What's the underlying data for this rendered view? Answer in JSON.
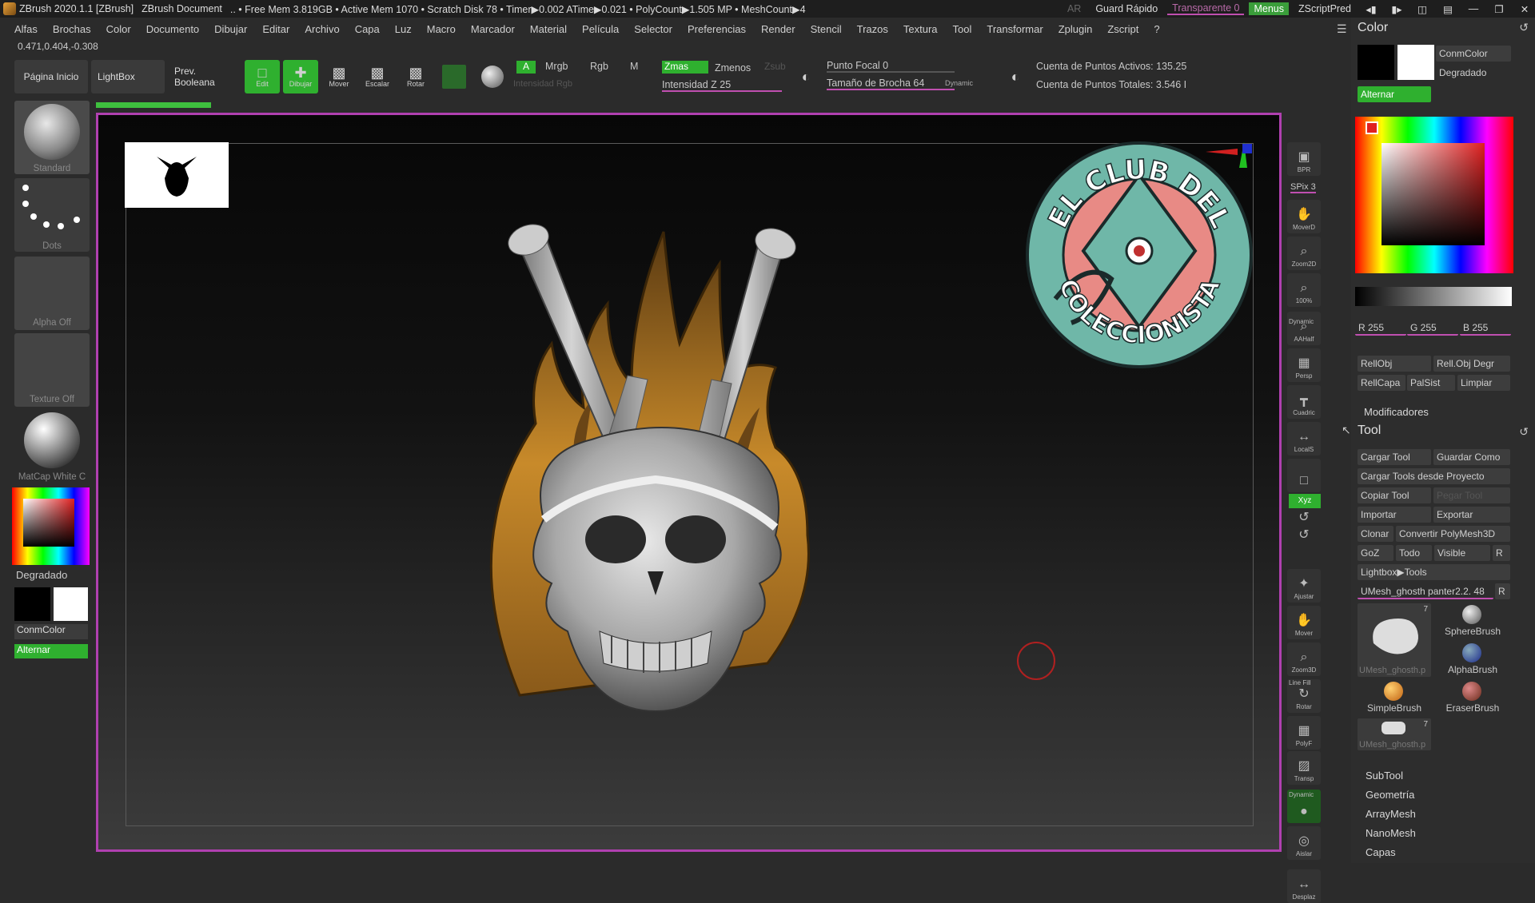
{
  "title_bar": {
    "app": "ZBrush 2020.1.1 [ZBrush]",
    "document": "ZBrush Document",
    "stats": ".. • Free Mem 3.819GB • Active Mem 1070 • Scratch Disk 78 •  Timer▶0.002 ATime▶0.021 • PolyCount▶1.505 MP  • MeshCount▶4",
    "ar": "AR",
    "guard_rapido": "Guard Rápido",
    "transparente": "Transparente 0",
    "menus": "Menus",
    "script": "ZScriptPred"
  },
  "menu_bar": [
    "Alfas",
    "Brochas",
    "Color",
    "Documento",
    "Dibujar",
    "Editar",
    "Archivo",
    "Capa",
    "Luz",
    "Macro",
    "Marcador",
    "Material",
    "Película",
    "Selector",
    "Preferencias",
    "Render",
    "Stencil",
    "Trazos",
    "Textura",
    "Tool",
    "Transformar",
    "Zplugin",
    "Zscript",
    "?"
  ],
  "coords": "0.471,0.404,-0.308",
  "top_tools": {
    "pagina_inicio": "Página Inicio",
    "lightbox": "LightBox",
    "prev_booleana": "Prev. Booleana",
    "edit": "Edit",
    "dibujar": "Dibujar",
    "mover": "Mover",
    "escalar": "Escalar",
    "rotar": "Rotar",
    "a": "A",
    "mrgb": "Mrgb",
    "rgb": "Rgb",
    "m": "M",
    "intensidad_rgb": "Intensidad Rgb",
    "zmas": "Zmas",
    "zmenos": "Zmenos",
    "zsub": "Zsub",
    "intensidad_z": "Intensidad Z 25",
    "punto_focal": "Punto Focal 0",
    "tamano_brocha": "Tamaño de Brocha 64",
    "dynamic": "Dynamic",
    "puntos_activos": "Cuenta de Puntos Activos: 135.25",
    "puntos_totales": "Cuenta de Puntos Totales: 3.546 I"
  },
  "left_shelf": {
    "brush": "Standard",
    "stroke": "Dots",
    "alpha": "Alpha Off",
    "texture": "Texture Off",
    "material": "MatCap White C",
    "gradient": "Degradado",
    "conmcolor": "ConmColor",
    "alternar": "Alternar"
  },
  "right_toolbar": [
    "BPR",
    "SPix 3",
    "MoverD",
    "Zoom2D",
    "100%",
    "AAHalf",
    "Persp",
    "Cuadric",
    "LocalS",
    "",
    "Xyz",
    "",
    "",
    "Ajustar",
    "Mover",
    "Zoom3D",
    "Rotar",
    "PolyF",
    "Transp",
    "",
    "Aislar",
    "Desplaz"
  ],
  "right_toolbar_labels": {
    "dynamic": "Dynamic",
    "line_fill": "Line Fill"
  },
  "color_panel": {
    "title": "Color",
    "conmcolor": "ConmColor",
    "degradado": "Degradado",
    "alternar": "Alternar",
    "r": "R 255",
    "g": "G 255",
    "b": "B 255",
    "rellobj": "RellObj",
    "rellobj_degr": "Rell.Obj Degr",
    "rellcapa": "RellCapa",
    "palsist": "PalSist",
    "limpiar": "Limpiar",
    "modificadores": "Modificadores"
  },
  "tool_panel": {
    "title": "Tool",
    "cargar_tool": "Cargar Tool",
    "guardar_como": "Guardar Como",
    "cargar_proyecto": "Cargar Tools desde Proyecto",
    "copiar_tool": "Copiar Tool",
    "pegar_tool": "Pegar Tool",
    "importar": "Importar",
    "exportar": "Exportar",
    "clonar": "Clonar",
    "convertir": "Convertir PolyMesh3D",
    "goz": "GoZ",
    "todo": "Todo",
    "visible": "Visible",
    "r": "R",
    "lightbox_tools": "Lightbox▶Tools",
    "current_tool": "UMesh_ghosth panter2.2. 48",
    "thumbs": [
      "UMesh_ghosth.p",
      "SphereBrush",
      "AlphaBrush",
      "SimpleBrush",
      "EraserBrush",
      "UMesh_ghosth.p"
    ],
    "thumb_count": "7",
    "subpanels": [
      "SubTool",
      "Geometría",
      "ArrayMesh",
      "NanoMesh",
      "Capas"
    ]
  },
  "badge": {
    "top_text": "EL CLUB DEL",
    "bottom_text": "COLECCIONISTA"
  },
  "colors": {
    "accent_green": "#2fb02f",
    "frame_magenta": "#b040b0",
    "flame": "#c88a2a",
    "badge_teal": "#6fb7a8",
    "badge_pink": "#e88a85"
  }
}
